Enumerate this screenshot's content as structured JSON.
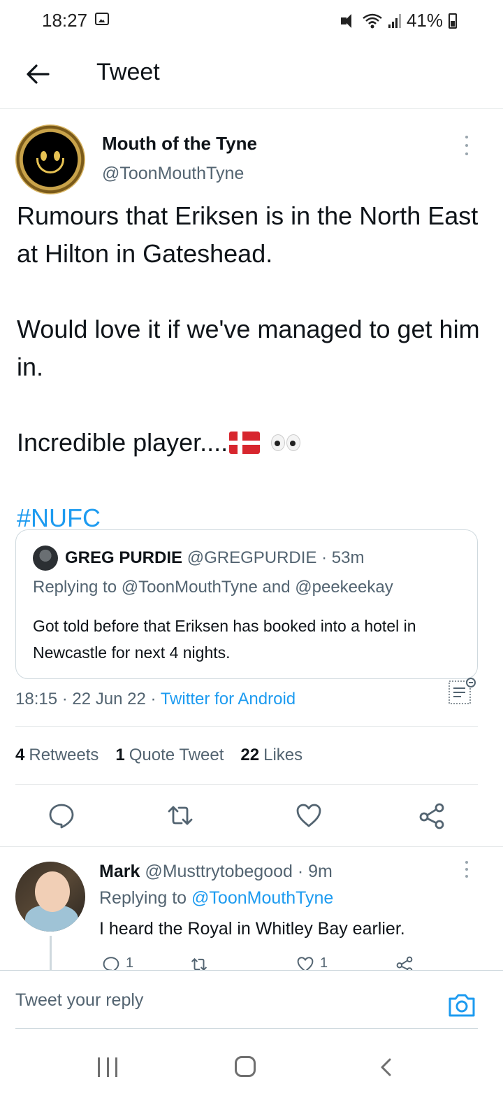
{
  "status_bar": {
    "time": "18:27",
    "battery": "41%",
    "icons": [
      "image-icon",
      "mute-icon",
      "wifi-icon",
      "signal-icon",
      "battery-icon"
    ]
  },
  "header": {
    "title": "Tweet",
    "back_icon": "arrow-left-icon"
  },
  "tweet": {
    "author_name": "Mouth of the Tyne",
    "author_handle": "@ToonMouthTyne",
    "body": {
      "line1": "Rumours that Eriksen is in the North East at Hilton in Gateshead.",
      "line2": "Would love it if we've managed to get him in.",
      "line3": "Incredible player....",
      "hashtag": "#NUFC"
    },
    "quoted": {
      "name": "GREG PURDIE",
      "handle_time": "@GREGPURDIE · 53m",
      "replying": "Replying to @ToonMouthTyne and @peekeekay",
      "text": "Got told before that Eriksen has booked into a hotel in Newcastle for next 4 nights."
    },
    "timestamp": "18:15 · 22 Jun 22 · ",
    "source": "Twitter for Android",
    "stats": {
      "retweets_count": "4",
      "retweets_label": "Retweets",
      "quotes_count": "1",
      "quotes_label": "Quote Tweet",
      "likes_count": "22",
      "likes_label": "Likes"
    }
  },
  "reply": {
    "name": "Mark",
    "handle_time": "@Musttrytobegood · 9m",
    "replying_prefix": "Replying to ",
    "replying_to": "@ToonMouthTyne",
    "text": "I heard the Royal in Whitley Bay earlier.",
    "reply_count": "1",
    "like_count": "1"
  },
  "composer": {
    "placeholder": "Tweet your reply"
  },
  "colors": {
    "accent": "#1d9bf0",
    "secondary_text": "#536471",
    "flag_red": "#d7262e"
  }
}
